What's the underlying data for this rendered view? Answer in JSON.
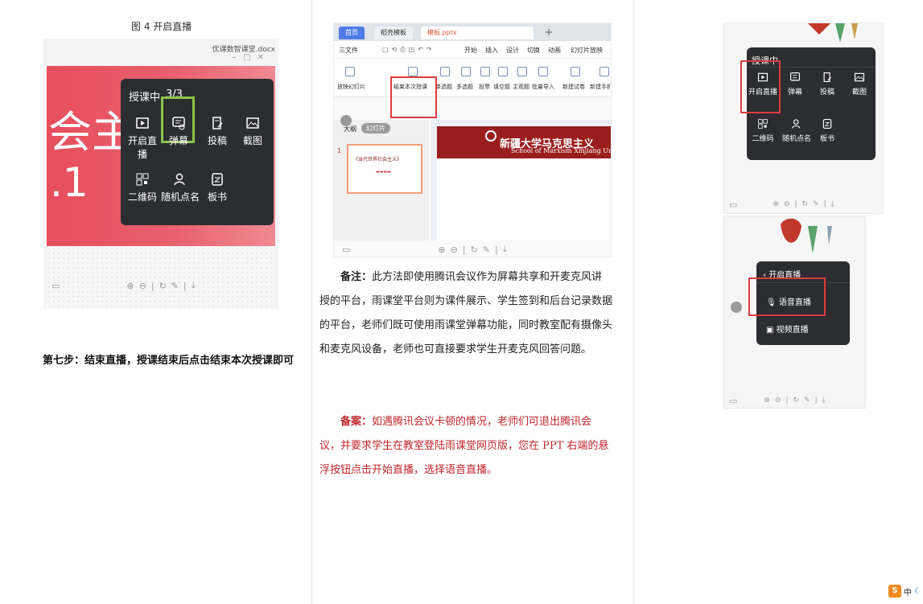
{
  "figure_caption": "图 4 开启直播",
  "panel1": {
    "title": "授课中",
    "counter": "3/3",
    "items": [
      "开启直播",
      "弹幕",
      "投稿",
      "截图",
      "二维码",
      "随机点名",
      "板书"
    ],
    "slide_text_1": "会主义",
    "slide_text_2": ".1",
    "doc_tab": "优课数智课堂.docx"
  },
  "step7": "第七步：结束直播，授课结束后点击结束本次授课即可",
  "wps": {
    "tabs": [
      "首页",
      "稻壳模板",
      "模板.pptx"
    ],
    "menu": [
      "三文件",
      "开始",
      "插入",
      "设计",
      "切换",
      "动画",
      "幻灯片放映"
    ],
    "ribbon": [
      "放映幻灯片",
      "结束本次授课",
      "单选题",
      "多选题",
      "投票",
      "填空题",
      "主观题",
      "批量导入",
      "新建试卷",
      "新建手机"
    ],
    "pane_tabs": [
      "大纲",
      "幻灯片"
    ],
    "slide_num": "1",
    "thumb_title": "《当代世界社会主义》",
    "slide_banner": "新疆大学马克思主义",
    "slide_sub": "School of Marxism Xinjiang Univ"
  },
  "note": {
    "label": "备注：",
    "text": "此方法即使用腾讯会议作为屏幕共享和开麦克风讲授的平台，雨课堂平台则为课件展示、学生签到和后台记录数据的平台，老师们既可使用雨课堂弹幕功能，同时教室配有摄像头和麦克风设备，老师也可直接要求学生开麦克风回答问题。"
  },
  "backup": {
    "label": "备案：",
    "text": "如遇腾讯会议卡顿的情况，老师们可退出腾讯会议，并要求学生在教室登陆雨课堂网页版，您在 PPT 右端的悬浮按钮点击开始直播，选择语音直播。"
  },
  "panel3": {
    "title": "授课中",
    "items": [
      "开启直播",
      "弹幕",
      "投稿",
      "截图",
      "二维码",
      "随机点名",
      "板书"
    ]
  },
  "panel4": {
    "back": "开启直播",
    "audio": "语音直播",
    "video": "视频直播"
  },
  "ime": "中"
}
